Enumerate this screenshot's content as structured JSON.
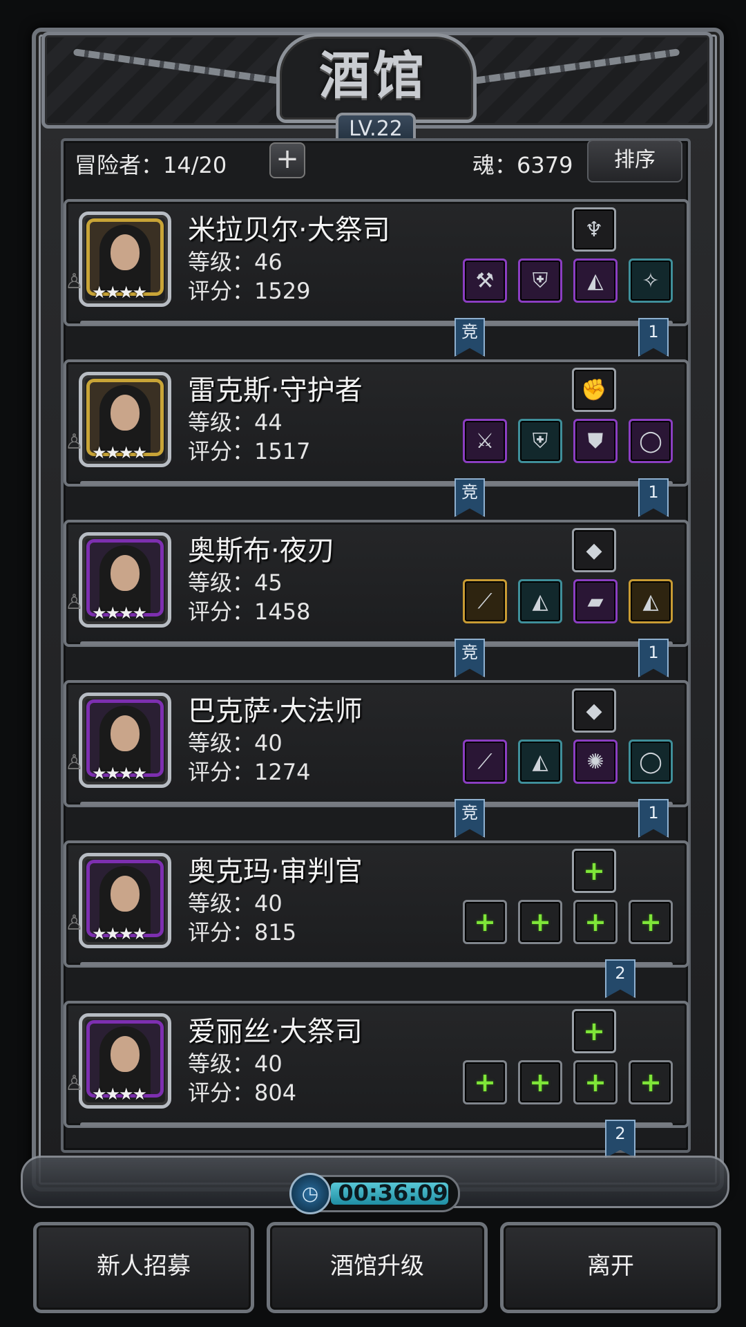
{
  "header": {
    "title": "酒馆",
    "level": "LV.22"
  },
  "topbar": {
    "adventurers_label": "冒险者：14/20",
    "add_icon": "plus-icon",
    "soul_label": "魂：6379",
    "sort_label": "排序"
  },
  "heroes": [
    {
      "name": "米拉贝尔·大祭司",
      "level": "等级：46",
      "score": "评分：1529",
      "frame": "gold",
      "stars": "★★★★",
      "top_item": "necklace-icon",
      "items": [
        "hammer-icon",
        "armor-icon",
        "cloak-icon",
        "charm-icon"
      ],
      "item_quality": [
        "purple",
        "purple",
        "purple",
        "teal"
      ],
      "top_quality": "white",
      "ribbon_left": "竞",
      "ribbon_right": "1"
    },
    {
      "name": "雷克斯·守护者",
      "level": "等级：44",
      "score": "评分：1517",
      "frame": "gold",
      "stars": "★★★★",
      "top_item": "gauntlet-icon",
      "items": [
        "sword-icon",
        "armor-icon",
        "shoulder-icon",
        "ring-icon"
      ],
      "item_quality": [
        "purple",
        "teal",
        "purple",
        "purple"
      ],
      "top_quality": "white",
      "ribbon_left": "竞",
      "ribbon_right": "1"
    },
    {
      "name": "奥斯布·夜刃",
      "level": "等级：45",
      "score": "评分：1458",
      "frame": "purple",
      "stars": "★★★★",
      "top_item": "crystal-icon",
      "items": [
        "blade-icon",
        "cloak-icon",
        "bracer-icon",
        "robe-icon"
      ],
      "item_quality": [
        "gold",
        "teal",
        "purple",
        "gold"
      ],
      "top_quality": "white",
      "ribbon_left": "竞",
      "ribbon_right": "1"
    },
    {
      "name": "巴克萨·大法师",
      "level": "等级：40",
      "score": "评分：1274",
      "frame": "purple",
      "stars": "★★★★",
      "top_item": "crystal-icon",
      "items": [
        "staff-icon",
        "cloak-icon",
        "amulet-icon",
        "ring-icon"
      ],
      "item_quality": [
        "purple",
        "teal",
        "purple",
        "teal"
      ],
      "top_quality": "white",
      "ribbon_left": "竞",
      "ribbon_right": "1"
    },
    {
      "name": "奥克玛·审判官",
      "level": "等级：40",
      "score": "评分：815",
      "frame": "purple",
      "stars": "★★★★",
      "top_item": "add-slot-icon",
      "items": [
        "add-weapon-icon",
        "add-armor-icon",
        "add-slot-icon",
        "add-slot-icon"
      ],
      "item_quality": [
        "empty",
        "empty",
        "empty",
        "empty"
      ],
      "top_quality": "empty",
      "ribbon_left": "",
      "ribbon_right": "2"
    },
    {
      "name": "爱丽丝·大祭司",
      "level": "等级：40",
      "score": "评分：804",
      "frame": "purple",
      "stars": "★★★★",
      "top_item": "add-slot-icon",
      "items": [
        "add-weapon-icon",
        "add-armor-icon",
        "add-slot-icon",
        "add-slot-icon"
      ],
      "item_quality": [
        "empty",
        "empty",
        "empty",
        "empty"
      ],
      "top_quality": "empty",
      "ribbon_left": "",
      "ribbon_right": "2"
    }
  ],
  "timer": {
    "value": "00:36:09",
    "icon": "clock-icon"
  },
  "buttons": {
    "recruit": "新人招募",
    "upgrade": "酒馆升级",
    "leave": "离开"
  },
  "colors": {
    "gold_frame": "#c8a437",
    "purple_frame": "#7d2fb0",
    "ribbon": "#24496a",
    "timer_bar": "#58c7d6",
    "add_green": "#7fe639"
  }
}
